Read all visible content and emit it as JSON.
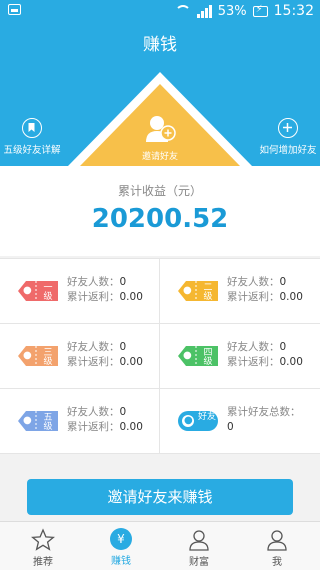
{
  "status_bar": {
    "battery": "53%",
    "time": "15:32"
  },
  "header": {
    "title": "赚钱",
    "left_button": "五级好友详解",
    "center_button": "邀请好友",
    "right_button": "如何增加好友"
  },
  "stats": {
    "label": "累计收益（元）",
    "amount": "20200.52"
  },
  "levels": [
    {
      "tag": "一级",
      "color": "#ef6a6a",
      "friends_label": "好友人数：",
      "friends_value": "0",
      "rebate_label": "累计返利：",
      "rebate_value": "0.00"
    },
    {
      "tag": "二级",
      "color": "#f5b731",
      "friends_label": "好友人数：",
      "friends_value": "0",
      "rebate_label": "累计返利：",
      "rebate_value": "0.00"
    },
    {
      "tag": "三级",
      "color": "#f3a26d",
      "friends_label": "好友人数：",
      "friends_value": "0",
      "rebate_label": "累计返利：",
      "rebate_value": "0.00"
    },
    {
      "tag": "四级",
      "color": "#4cc266",
      "friends_label": "好友人数：",
      "friends_value": "0",
      "rebate_label": "累计返利：",
      "rebate_value": "0.00"
    },
    {
      "tag": "五级",
      "color": "#7ea5e6",
      "friends_label": "好友人数：",
      "friends_value": "0",
      "rebate_label": "累计返利：",
      "rebate_value": "0.00"
    }
  ],
  "total_friends": {
    "tag": "好友",
    "color": "#29abe2",
    "label": "累计好友总数：",
    "value": "0"
  },
  "cta_label": "邀请好友来赚钱",
  "tabs": [
    {
      "label": "推荐",
      "icon": "star-icon",
      "active": false
    },
    {
      "label": "赚钱",
      "icon": "yen-icon",
      "active": true
    },
    {
      "label": "财富",
      "icon": "user-icon",
      "active": false
    },
    {
      "label": "我",
      "icon": "profile-icon",
      "active": false
    }
  ],
  "colors": {
    "primary": "#29abe2",
    "triangle": "#f7c04a",
    "accent_text": "#1a9ad6"
  }
}
